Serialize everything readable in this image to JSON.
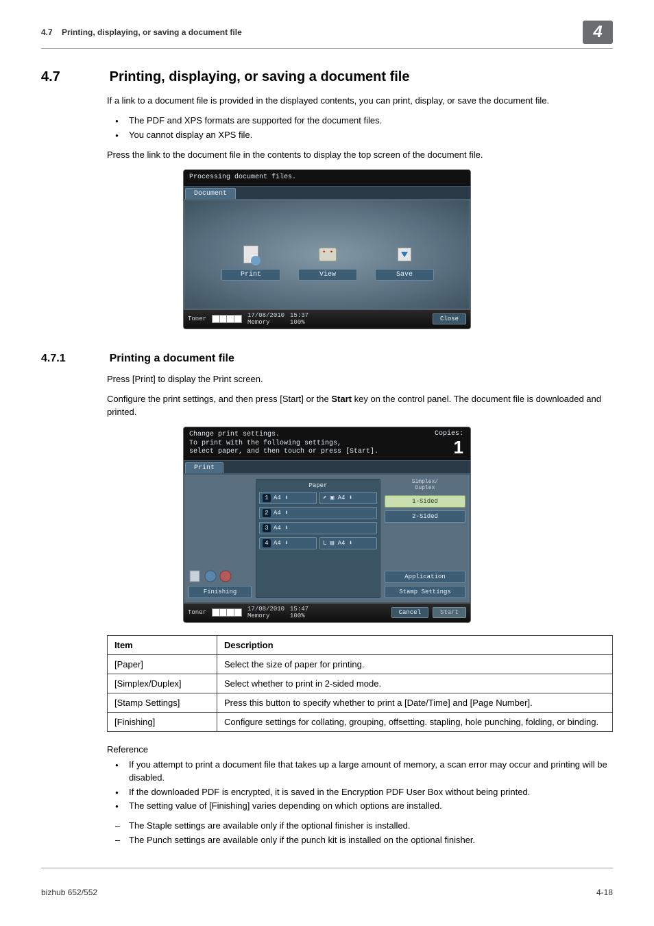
{
  "running_header": {
    "section_no": "4.7",
    "title": "Printing, displaying, or saving a document file",
    "chapter_no": "4"
  },
  "h47": {
    "num": "4.7",
    "title": "Printing, displaying, or saving a document file"
  },
  "p1": "If a link to a document file is provided in the displayed contents, you can print, display, or save the document file.",
  "b1": "The PDF and XPS formats are supported for the document files.",
  "b2": "You cannot display an XPS file.",
  "p2": "Press the link to the document file in the contents to display the top screen of the document file.",
  "screen1": {
    "msg": "Processing document files.",
    "tab": "Document",
    "btn_print": "Print",
    "btn_view": "View",
    "btn_save": "Save",
    "toner": "Toner",
    "date": "17/08/2010",
    "time": "15:37",
    "memory": "Memory",
    "mempct": "100%",
    "close": "Close"
  },
  "h471": {
    "num": "4.7.1",
    "title": "Printing a document file"
  },
  "p3": "Press [Print] to display the Print screen.",
  "p4a": "Configure the print settings, and then press [Start] or the ",
  "p4b": "Start",
  "p4c": " key on the control panel. The document file is downloaded and printed.",
  "screen2": {
    "msg_l1": "Change print settings.",
    "msg_l2": "To print with the following settings,",
    "msg_l3": "select paper, and then touch or press [Start].",
    "copies_label": "Copies:",
    "copies_value": "1",
    "tab": "Print",
    "paper_hdr": "Paper",
    "sd_hdr": "Simplex/\nDuplex",
    "trays": [
      {
        "n": "1",
        "label": "A4 ⬇",
        "extra": "⬈ ▣ A4 ⬇"
      },
      {
        "n": "2",
        "label": "A4 ⬇",
        "extra": ""
      },
      {
        "n": "3",
        "label": "A4 ⬇",
        "extra": ""
      },
      {
        "n": "4",
        "label": "A4 ⬇",
        "extra": "L ▤ A4 ⬇"
      }
    ],
    "opt_1sided": "1-Sided",
    "opt_2sided": "2-Sided",
    "app": "Application",
    "stamp": "Stamp Settings",
    "finishing": "Finishing",
    "toner": "Toner",
    "date": "17/08/2010",
    "time": "15:47",
    "memory": "Memory",
    "mempct": "100%",
    "cancel": "Cancel",
    "start": "Start"
  },
  "table": {
    "h1": "Item",
    "h2": "Description",
    "rows": [
      {
        "item": "[Paper]",
        "desc": "Select the size of paper for printing."
      },
      {
        "item": "[Simplex/Duplex]",
        "desc": "Select whether to print in 2-sided mode."
      },
      {
        "item": "[Stamp Settings]",
        "desc": "Press this button to specify whether to print a [Date/Time] and [Page Number]."
      },
      {
        "item": "[Finishing]",
        "desc": "Configure settings for collating, grouping, offsetting. stapling, hole punching, folding, or binding."
      }
    ]
  },
  "reference": {
    "label": "Reference",
    "items": [
      {
        "t": "bullet",
        "text": "If you attempt to print a document file that takes up a large amount of memory, a scan error may occur and printing will be disabled."
      },
      {
        "t": "bullet",
        "text": "If the downloaded PDF is encrypted, it is saved in the Encryption PDF User Box without being printed."
      },
      {
        "t": "bullet",
        "text": "The setting value of [Finishing] varies depending on which options are installed."
      },
      {
        "t": "dash",
        "text": "The Staple settings are available only if the optional finisher is installed."
      },
      {
        "t": "dash",
        "text": "The Punch settings are available only if the punch kit is installed on the optional finisher."
      }
    ]
  },
  "footer": {
    "left": "bizhub 652/552",
    "right": "4-18"
  }
}
